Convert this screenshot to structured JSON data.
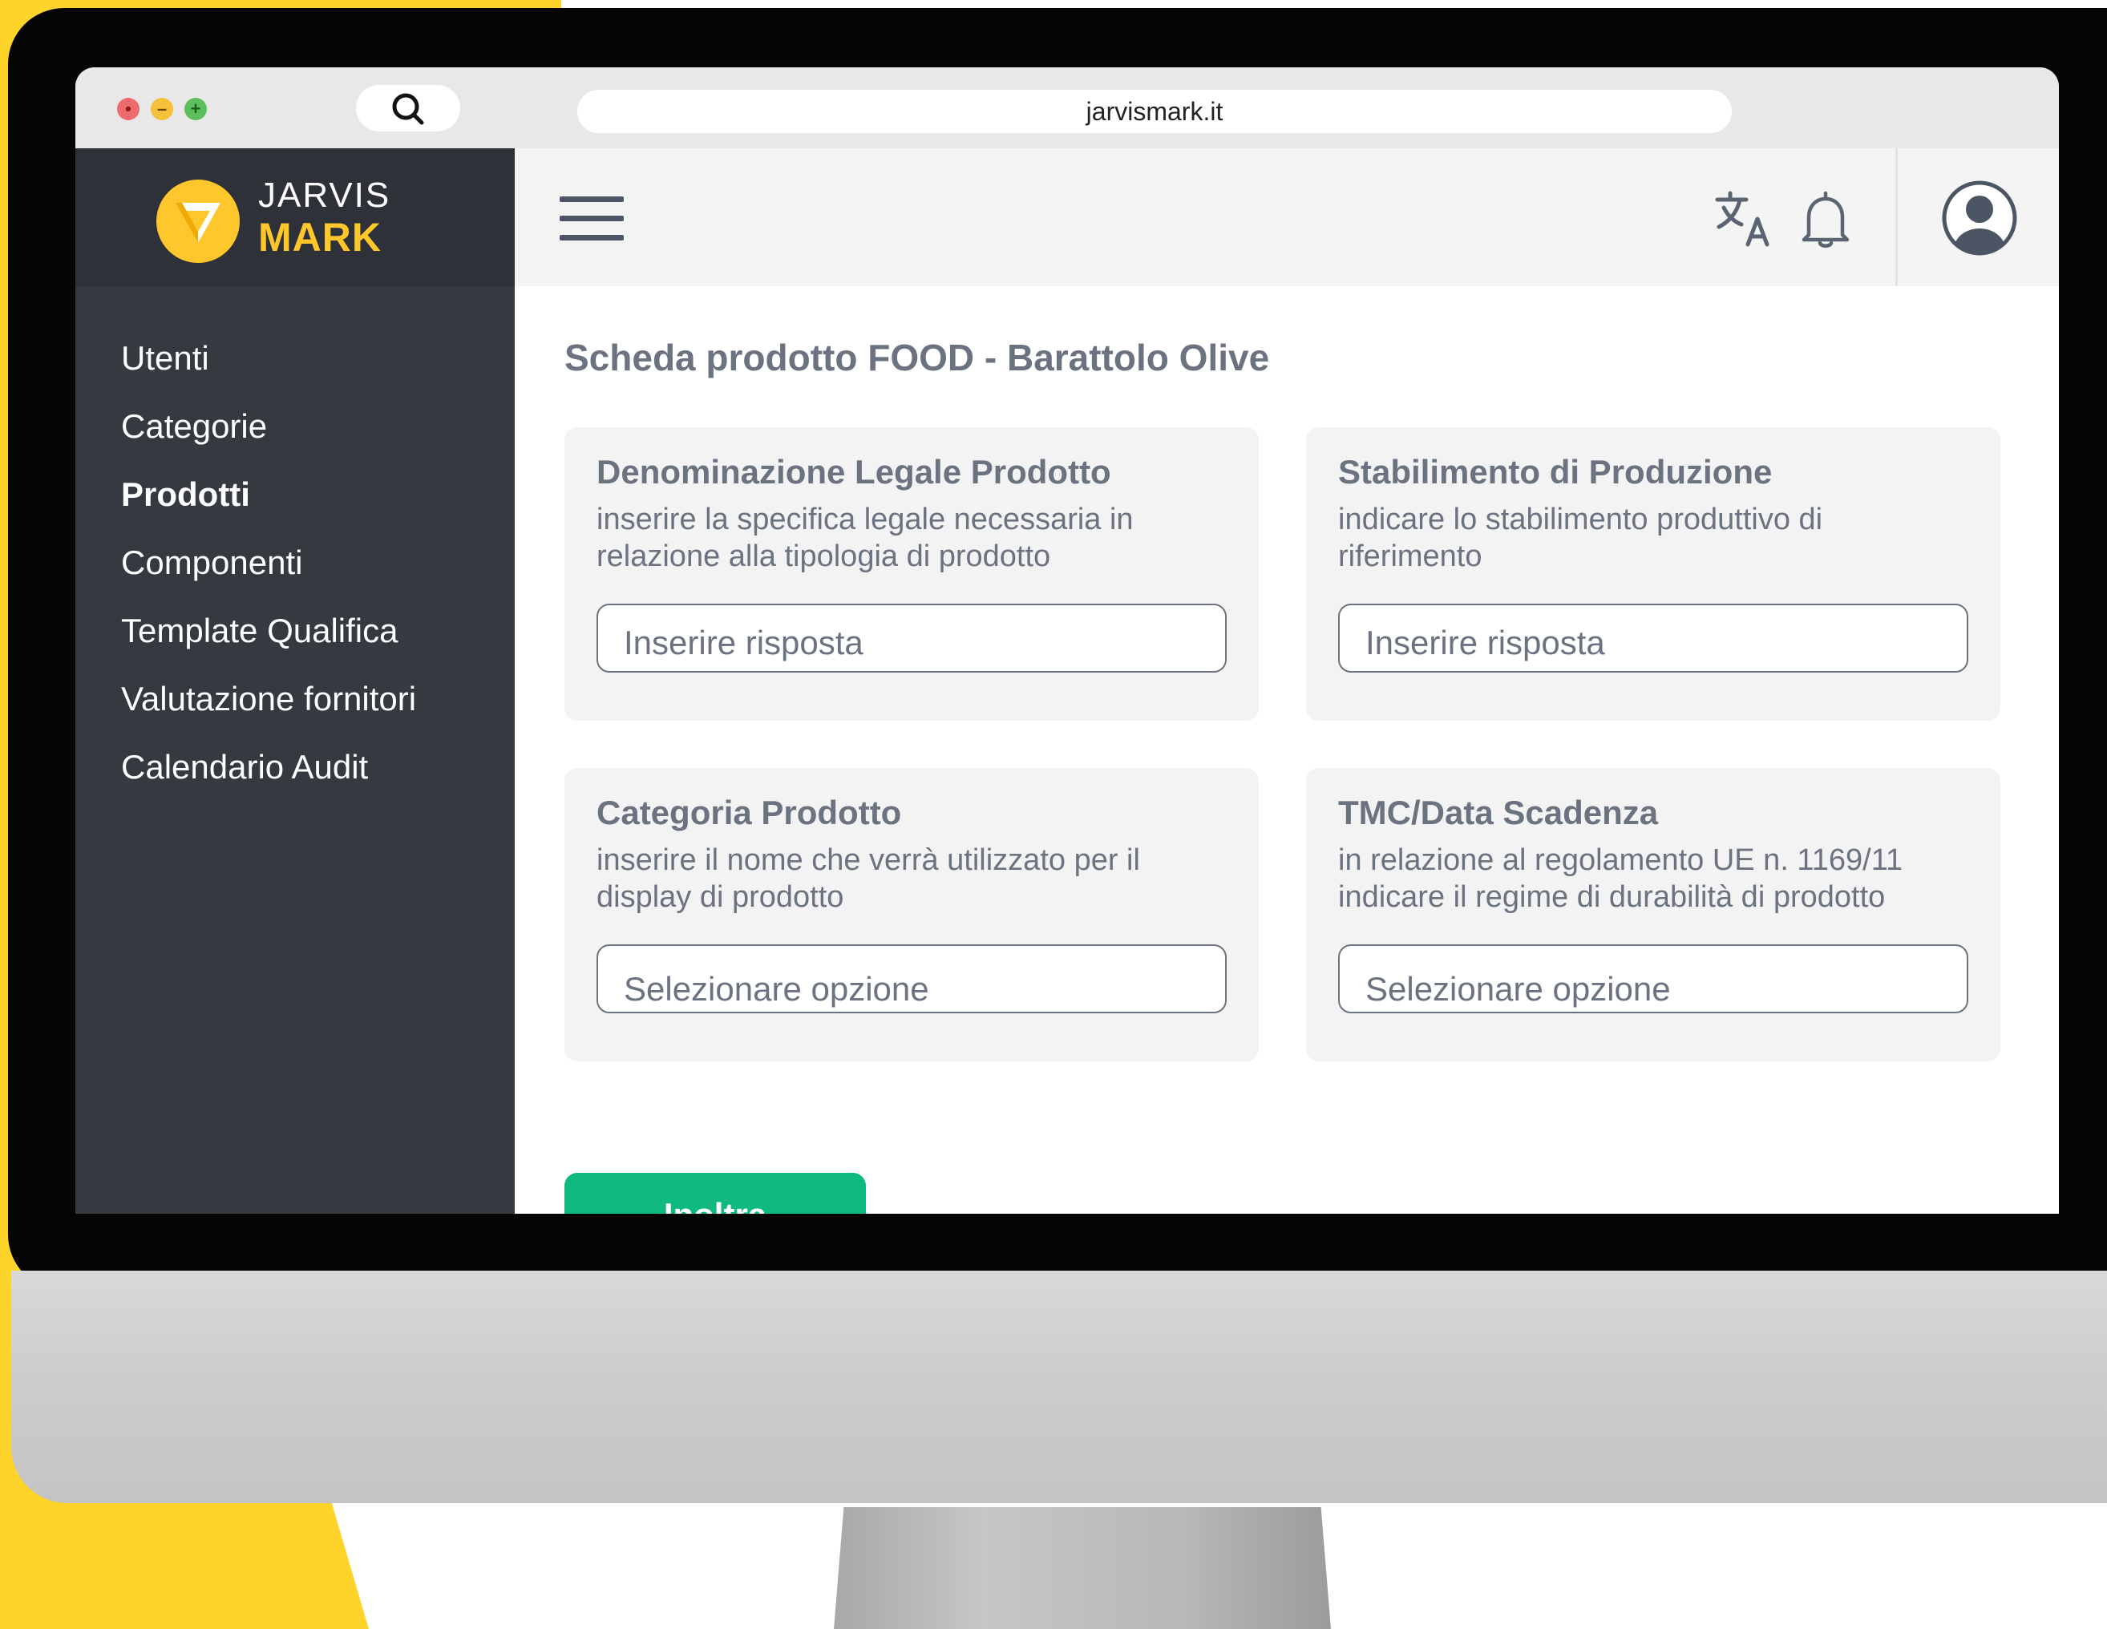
{
  "browser": {
    "url": "jarvismark.it"
  },
  "brand": {
    "line1": "JARVIS",
    "line2": "MARK",
    "accent_color": "#FFC72C"
  },
  "sidebar": {
    "items": [
      {
        "label": "Utenti",
        "active": false
      },
      {
        "label": "Categorie",
        "active": false
      },
      {
        "label": "Prodotti",
        "active": true
      },
      {
        "label": "Componenti",
        "active": false
      },
      {
        "label": "Template Qualifica",
        "active": false
      },
      {
        "label": "Valutazione fornitori",
        "active": false
      },
      {
        "label": "Calendario Audit",
        "active": false
      }
    ]
  },
  "topbar": {
    "icons": [
      "hamburger-menu-icon",
      "translate-icon",
      "bell-icon",
      "user-avatar-icon"
    ]
  },
  "main": {
    "title": "Scheda prodotto FOOD - Barattolo Olive",
    "cards": [
      {
        "title": "Denominazione Legale Prodotto",
        "description": "inserire la specifica legale necessaria in relazione alla tipologia di prodotto",
        "field_type": "text",
        "placeholder": "Inserire risposta"
      },
      {
        "title": "Stabilimento di Produzione",
        "description": "indicare lo stabilimento produttivo di riferimento",
        "field_type": "text",
        "placeholder": "Inserire risposta"
      },
      {
        "title": "Categoria Prodotto",
        "description": "inserire il nome che verrà utilizzato per il display di prodotto",
        "field_type": "select",
        "placeholder": "Selezionare opzione"
      },
      {
        "title": "TMC/Data Scadenza",
        "description": "in relazione al regolamento UE n. 1169/11 indicare il regime di durabilità di prodotto",
        "field_type": "select",
        "placeholder": "Selezionare opzione"
      }
    ],
    "submit_label": "Inoltra compilazione",
    "submit_color": "#10b981"
  }
}
